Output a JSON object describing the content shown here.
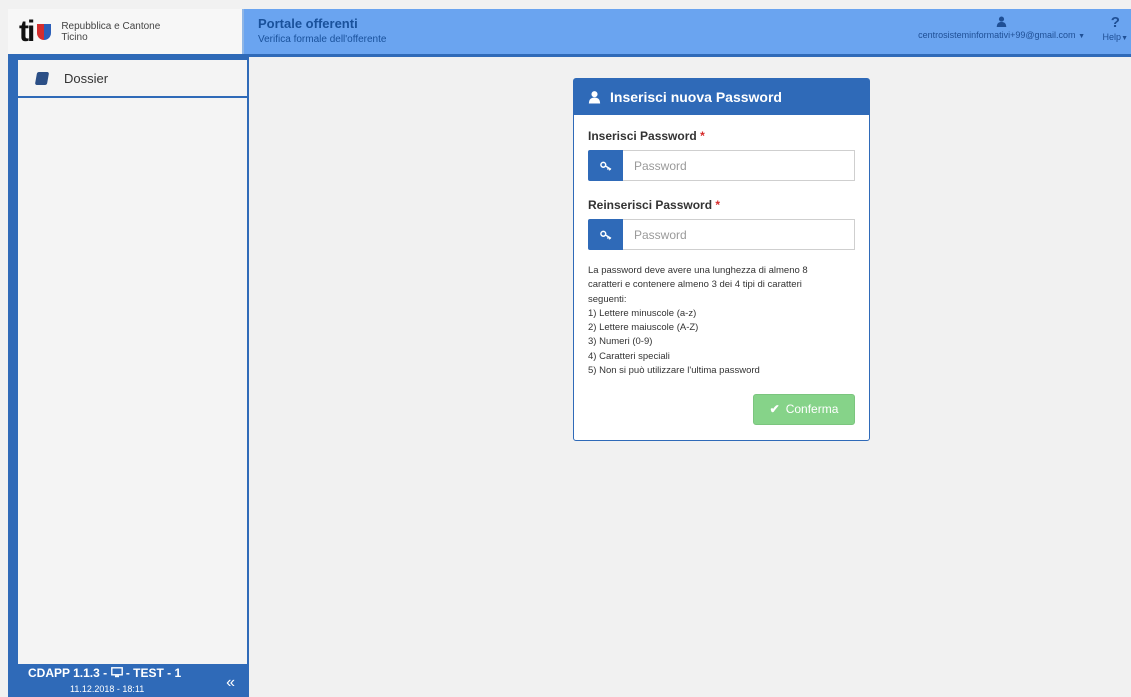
{
  "brand": {
    "logo_text": "ti",
    "line1": "Repubblica e Cantone",
    "line2": "Ticino"
  },
  "portal": {
    "title": "Portale offerenti",
    "subtitle": "Verifica formale dell'offerente"
  },
  "user": {
    "email": "centrosisteminformativi+99@gmail.com"
  },
  "help": {
    "icon": "?",
    "label": "Help"
  },
  "sidebar": {
    "items": [
      {
        "label": "Dossier",
        "icon": "book-icon"
      }
    ],
    "footer": {
      "version": "CDAPP 1.1.3 -",
      "env": "- TEST - 1",
      "date": "11.12.2018 - 18:11",
      "collapse_icon": "«"
    }
  },
  "card": {
    "title": "Inserisci nuova Password",
    "field1": {
      "label": "Inserisci Password",
      "required": "*",
      "placeholder": "Password",
      "value": ""
    },
    "field2": {
      "label": "Reinserisci Password",
      "required": "*",
      "placeholder": "Password",
      "value": ""
    },
    "rules": [
      "La password deve avere una lunghezza di almeno 8",
      "caratteri e contenere almeno 3 dei 4 tipi di caratteri",
      "seguenti:",
      "1) Lettere minuscole (a-z)",
      "2) Lettere maiuscole (A-Z)",
      "3) Numeri (0-9)",
      "4) Caratteri speciali",
      "5) Non si può utilizzare l'ultima password"
    ],
    "confirm_label": "Conferma"
  },
  "colors": {
    "header_bg": "#6aa4f0",
    "primary": "#2f6ab8",
    "confirm_disabled": "#86d389",
    "required": "#d62b2b"
  }
}
